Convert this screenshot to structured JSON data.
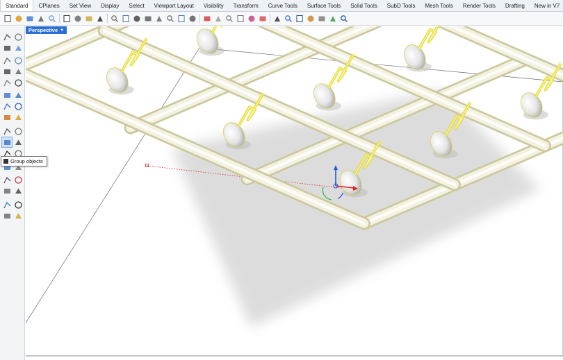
{
  "menu": {
    "tabs": [
      {
        "label": "Standard",
        "active": true
      },
      {
        "label": "CPlanes"
      },
      {
        "label": "Set View"
      },
      {
        "label": "Display"
      },
      {
        "label": "Select"
      },
      {
        "label": "Viewport Layout"
      },
      {
        "label": "Visibility"
      },
      {
        "label": "Transform"
      },
      {
        "label": "Curve Tools"
      },
      {
        "label": "Surface Tools"
      },
      {
        "label": "Solid Tools"
      },
      {
        "label": "SubD Tools"
      },
      {
        "label": "Mesh Tools"
      },
      {
        "label": "Render Tools"
      },
      {
        "label": "Drafting"
      },
      {
        "label": "New in V7"
      }
    ]
  },
  "toolbar": {
    "icons": [
      "new-icon",
      "open-icon",
      "save-icon",
      "print-icon",
      "import-icon",
      "cut-icon",
      "copy-icon",
      "paste-icon",
      "undo-icon",
      "pan-icon",
      "rotate-view-icon",
      "zoom-icon",
      "zoom-window-icon",
      "zoom-extents-icon",
      "zoom-selected-icon",
      "four-views-icon",
      "grid-icon",
      "cplane-icon",
      "show-icon",
      "hide-icon",
      "lock-icon",
      "layer-icon",
      "color-icon",
      "render-icon",
      "material-icon",
      "sphere-icon",
      "settings-icon",
      "options-icon",
      "grasshopper-icon",
      "help-icon"
    ]
  },
  "tooltip": {
    "text": "Group objects"
  },
  "viewport": {
    "label": "Perspective",
    "colors": {
      "selection": "#e6e03a",
      "ground": "#ffffff",
      "axis_x": "#e02020",
      "axis_y": "#2db24a",
      "axis_z": "#2155e0"
    }
  }
}
